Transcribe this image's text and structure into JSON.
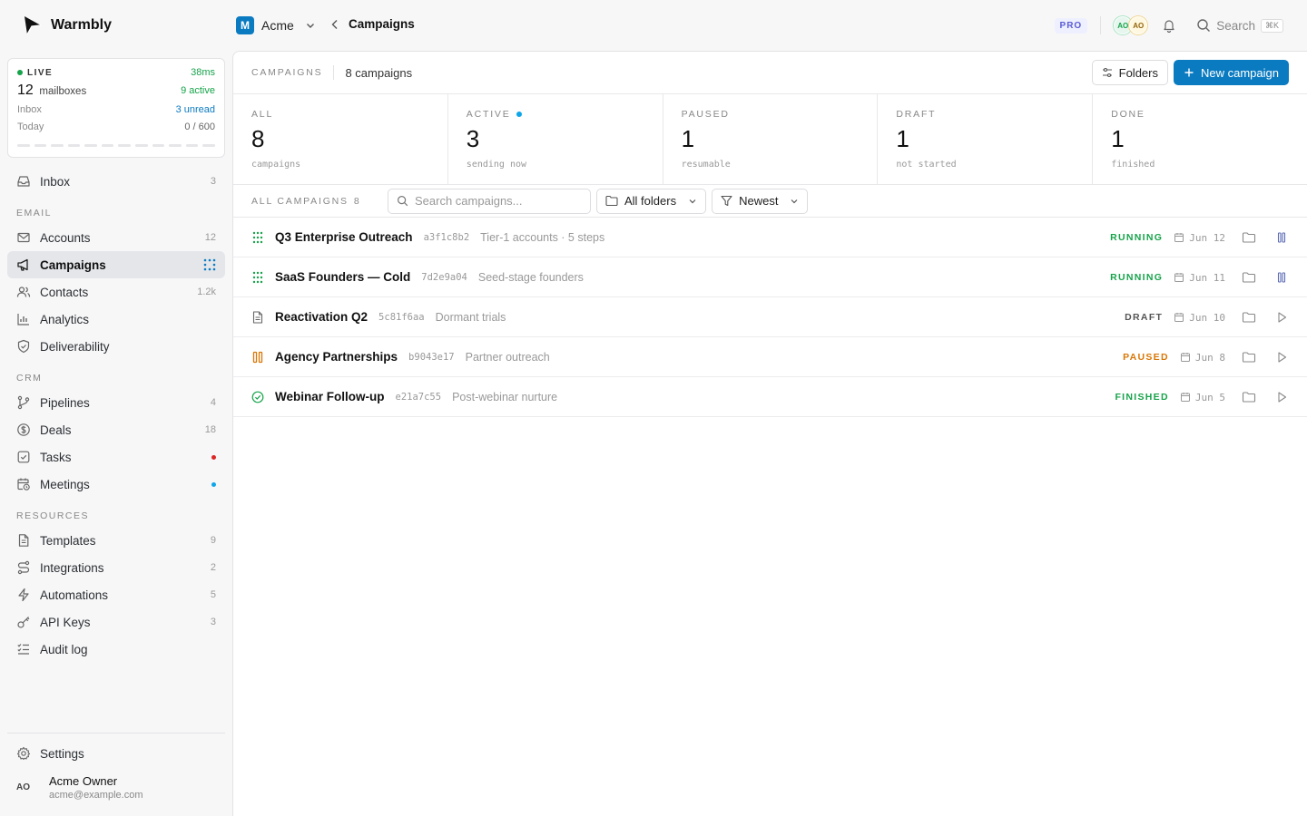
{
  "app": {
    "name": "Warmbly"
  },
  "workspace": {
    "badge": "M",
    "name": "Acme"
  },
  "breadcrumb": {
    "current": "Campaigns"
  },
  "topbar": {
    "plan": "PRO",
    "avatars": [
      "AO",
      "AO"
    ],
    "search_label": "Search",
    "search_shortcut": "⌘K"
  },
  "live": {
    "label": "LIVE",
    "latency": "38ms",
    "mailboxes_count": "12",
    "mailboxes_label": "mailboxes",
    "active": "9 active",
    "inbox_label": "Inbox",
    "inbox_value": "3 unread",
    "today_label": "Today",
    "today_value": "0 / 600"
  },
  "sidebar": {
    "inbox": {
      "label": "Inbox",
      "count": "3"
    },
    "sections": {
      "email": "EMAIL",
      "crm": "CRM",
      "resources": "RESOURCES"
    },
    "email": [
      {
        "label": "Accounts",
        "count": "12",
        "icon": "mail-icon"
      },
      {
        "label": "Campaigns",
        "count": "",
        "icon": "megaphone-icon"
      },
      {
        "label": "Contacts",
        "count": "1.2k",
        "icon": "users-icon"
      },
      {
        "label": "Analytics",
        "count": "",
        "icon": "bar-chart-icon"
      },
      {
        "label": "Deliverability",
        "count": "",
        "icon": "shield-icon"
      }
    ],
    "crm": [
      {
        "label": "Pipelines",
        "count": "4",
        "icon": "git-branch-icon"
      },
      {
        "label": "Deals",
        "count": "18",
        "icon": "dollar-icon"
      },
      {
        "label": "Tasks",
        "count": "",
        "icon": "checkbox-icon"
      },
      {
        "label": "Meetings",
        "count": "",
        "icon": "calendar-clock-icon"
      }
    ],
    "resources": [
      {
        "label": "Templates",
        "count": "9",
        "icon": "file-text-icon"
      },
      {
        "label": "Integrations",
        "count": "2",
        "icon": "route-icon"
      },
      {
        "label": "Automations",
        "count": "5",
        "icon": "bolt-icon"
      },
      {
        "label": "API Keys",
        "count": "3",
        "icon": "key-icon"
      },
      {
        "label": "Audit log",
        "count": "",
        "icon": "list-checks-icon"
      }
    ],
    "settings": "Settings",
    "user": {
      "initials": "AO",
      "name": "Acme Owner",
      "email": "acme@example.com"
    }
  },
  "main": {
    "header": {
      "label": "CAMPAIGNS",
      "count": "8 campaigns",
      "folders_btn": "Folders",
      "new_btn": "New campaign"
    },
    "stats": [
      {
        "label": "ALL",
        "value": "8",
        "sub": "campaigns"
      },
      {
        "label": "ACTIVE",
        "value": "3",
        "sub": "sending now"
      },
      {
        "label": "PAUSED",
        "value": "1",
        "sub": "resumable"
      },
      {
        "label": "DRAFT",
        "value": "1",
        "sub": "not started"
      },
      {
        "label": "DONE",
        "value": "1",
        "sub": "finished"
      }
    ],
    "filters": {
      "label": "ALL CAMPAIGNS",
      "count": "8",
      "search_placeholder": "Search campaigns...",
      "folder": "All folders",
      "sort": "Newest"
    },
    "campaigns": [
      {
        "name": "Q3 Enterprise Outreach",
        "id": "a3f1c8b2",
        "desc": "Tier-1 accounts · 5 steps",
        "status": "RUNNING",
        "date": "Jun 12"
      },
      {
        "name": "SaaS Founders — Cold",
        "id": "7d2e9a04",
        "desc": "Seed-stage founders",
        "status": "RUNNING",
        "date": "Jun 11"
      },
      {
        "name": "Reactivation Q2",
        "id": "5c81f6aa",
        "desc": "Dormant trials",
        "status": "DRAFT",
        "date": "Jun 10"
      },
      {
        "name": "Agency Partnerships",
        "id": "b9043e17",
        "desc": "Partner outreach",
        "status": "PAUSED",
        "date": "Jun 8"
      },
      {
        "name": "Webinar Follow-up",
        "id": "e21a7c55",
        "desc": "Post-webinar nurture",
        "status": "FINISHED",
        "date": "Jun 5"
      }
    ]
  },
  "colors": {
    "accent": "#0b7bc1",
    "running": "#16a34a",
    "paused": "#d97706",
    "draft": "#555555"
  }
}
